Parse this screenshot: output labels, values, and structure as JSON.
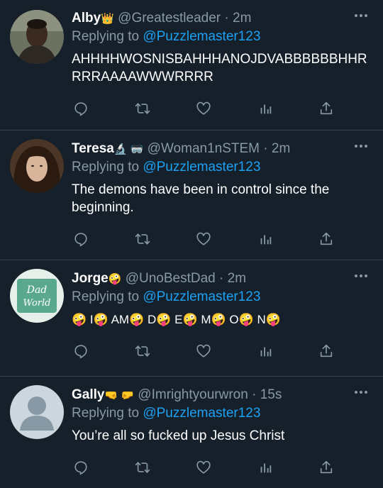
{
  "tweets": [
    {
      "name": "Alby",
      "name_tag": "👑",
      "handle": "@Greatestleader",
      "time": "2m",
      "reply_prefix": "Replying to",
      "reply_to": "@Puzzlemaster123",
      "text": "AHHHHWOSNISBAHHHANOJDVABBBBBBHHRRRRAAAAWWWRRRR"
    },
    {
      "name": "Teresa",
      "name_tag": "🔬 🥽",
      "handle": "@Woman1nSTEM",
      "time": "2m",
      "reply_prefix": "Replying to",
      "reply_to": "@Puzzlemaster123",
      "text": "The demons have been in control since the beginning."
    },
    {
      "name": "Jorge",
      "name_tag": "🤪",
      "handle": "@UnoBestDad",
      "time": "2m",
      "reply_prefix": "Replying to",
      "reply_to": "@Puzzlemaster123",
      "text": "🤪 I🤪 AM🤪 D🤪 E🤪 M🤪 O🤪 N🤪"
    },
    {
      "name": "Gally",
      "name_tag": "🤜 🤛",
      "handle": "@Imrightyourwron",
      "time": "15s",
      "reply_prefix": "Replying to",
      "reply_to": "@Puzzlemaster123",
      "text": "You’re all so fucked up Jesus Christ"
    }
  ],
  "separator": "·",
  "colors": {
    "background": "#15202b",
    "divider": "#38444d",
    "muted": "#8899a6",
    "link": "#1da1f2",
    "text": "#ffffff"
  },
  "icons": [
    "reply-icon",
    "retweet-icon",
    "like-icon",
    "analytics-icon",
    "share-icon",
    "more-icon"
  ]
}
